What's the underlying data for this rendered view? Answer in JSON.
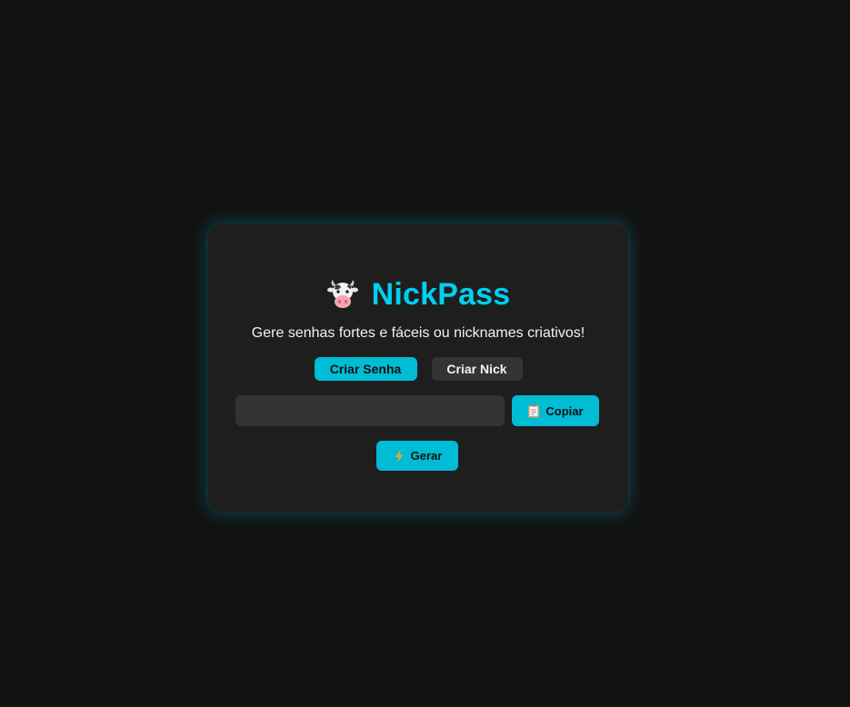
{
  "app": {
    "logo_icon": "cow-face-icon",
    "title": "NickPass",
    "subtitle": "Gere senhas fortes e fáceis ou nicknames criativos!"
  },
  "modes": {
    "password_label": "Criar Senha",
    "nick_label": "Criar Nick",
    "active": "password"
  },
  "output": {
    "value": "",
    "placeholder": ""
  },
  "actions": {
    "copy_label": "Copiar",
    "copy_icon": "clipboard-icon",
    "generate_label": "Gerar",
    "generate_icon": "lightning-icon"
  },
  "colors": {
    "accent": "#00bcd4",
    "title": "#00cff0",
    "background": "#121212",
    "card": "#1e1e1e",
    "input": "#333333"
  }
}
